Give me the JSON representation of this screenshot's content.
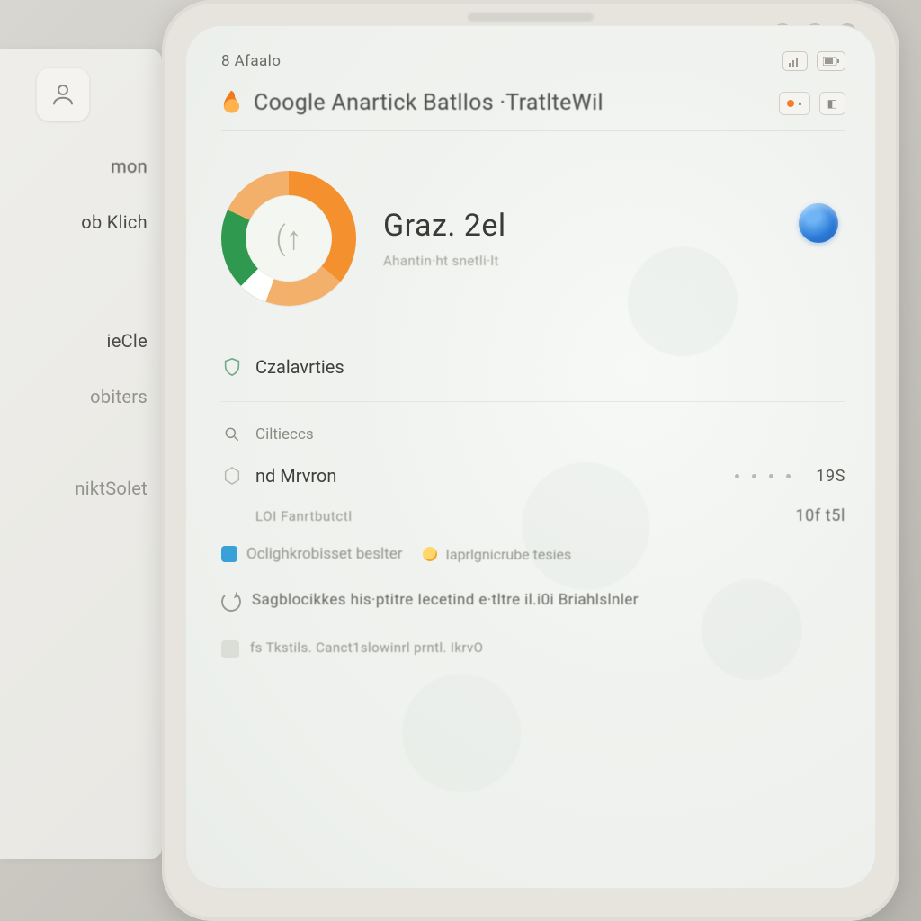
{
  "sidebar": {
    "items": [
      {
        "label": "mon"
      },
      {
        "label": "ob Klich"
      },
      {
        "label": "ieCle"
      },
      {
        "label": "obiters"
      },
      {
        "label": "niktSolet"
      }
    ]
  },
  "statusbar": {
    "time": "8 Afaalo"
  },
  "header": {
    "title": "Coogle Anartick Batllos ·TratlteWil"
  },
  "hero": {
    "ring_center": "(↑",
    "name": "Graz. 2el",
    "subtitle": "Ahantin·ht  snetli·lt"
  },
  "list": {
    "items": [
      {
        "label": "Czalavrties",
        "icon": "shield"
      },
      {
        "label": "Ciltieccs",
        "icon": "search",
        "sub": true
      },
      {
        "label": "nd Mrvron",
        "icon": "hex",
        "value_right": "19S",
        "dots": true
      },
      {
        "label": "LOI Fanrtbutctl",
        "muted": true,
        "value_right": "10f  t5l"
      },
      {
        "label": "Oclighkrobisset beslter",
        "chip": true,
        "extra_icon": "sun",
        "extra_label": "Iaprlgnicrube tesies"
      }
    ]
  },
  "paragraphs": {
    "p1": "Sagblocikkes his·ptitre  Iecetind e·tltre  il.i0i Briahlslnler",
    "p2": "fs  Tkstils. Canct1slowinrl  prntl. IkrvO"
  }
}
